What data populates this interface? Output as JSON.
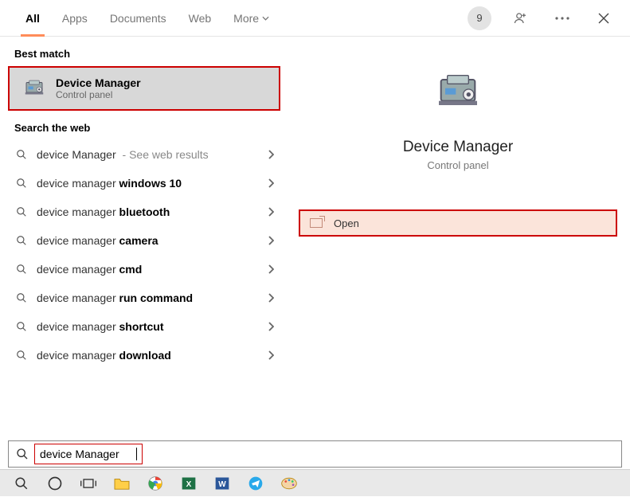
{
  "tabs": {
    "items": [
      "All",
      "Apps",
      "Documents",
      "Web",
      "More"
    ],
    "activeIndex": 0
  },
  "header": {
    "badge": "9"
  },
  "bestMatch": {
    "sectionTitle": "Best match",
    "title": "Device Manager",
    "subtitle": "Control panel"
  },
  "webSearch": {
    "sectionTitle": "Search the web",
    "items": [
      {
        "prefix": "device Manager",
        "bold": "",
        "hint": " - See web results"
      },
      {
        "prefix": "device manager ",
        "bold": "windows 10",
        "hint": ""
      },
      {
        "prefix": "device manager ",
        "bold": "bluetooth",
        "hint": ""
      },
      {
        "prefix": "device manager ",
        "bold": "camera",
        "hint": ""
      },
      {
        "prefix": "device manager ",
        "bold": "cmd",
        "hint": ""
      },
      {
        "prefix": "device manager ",
        "bold": "run command",
        "hint": ""
      },
      {
        "prefix": "device manager ",
        "bold": "shortcut",
        "hint": ""
      },
      {
        "prefix": "device manager ",
        "bold": "download",
        "hint": ""
      }
    ]
  },
  "preview": {
    "title": "Device Manager",
    "subtitle": "Control panel",
    "action": "Open"
  },
  "search": {
    "value": "device Manager"
  }
}
